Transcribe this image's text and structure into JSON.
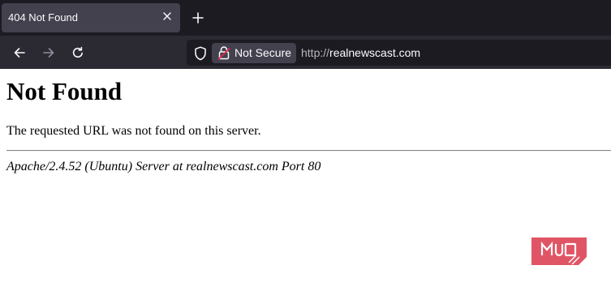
{
  "tab": {
    "title": "404 Not Found"
  },
  "toolbar": {
    "new_tab_icon": "plus-icon",
    "back_icon": "arrow-left-icon",
    "forward_icon": "arrow-right-icon",
    "reload_icon": "reload-icon"
  },
  "urlbar": {
    "security_label": "Not Secure",
    "url_scheme": "http://",
    "url_host": "realnewscast.com"
  },
  "page": {
    "heading": "Not Found",
    "message": "The requested URL was not found on this server.",
    "server_signature": "Apache/2.4.52 (Ubuntu) Server at realnewscast.com Port 80"
  },
  "watermark": {
    "text": "MUO"
  },
  "colors": {
    "tabstrip_bg": "#1c1b22",
    "active_tab_bg": "#42414d",
    "navbar_bg": "#2b2a33",
    "urlbar_bg": "#1c1b22",
    "insecure_lock": "#e22850",
    "watermark": "#e05565"
  }
}
